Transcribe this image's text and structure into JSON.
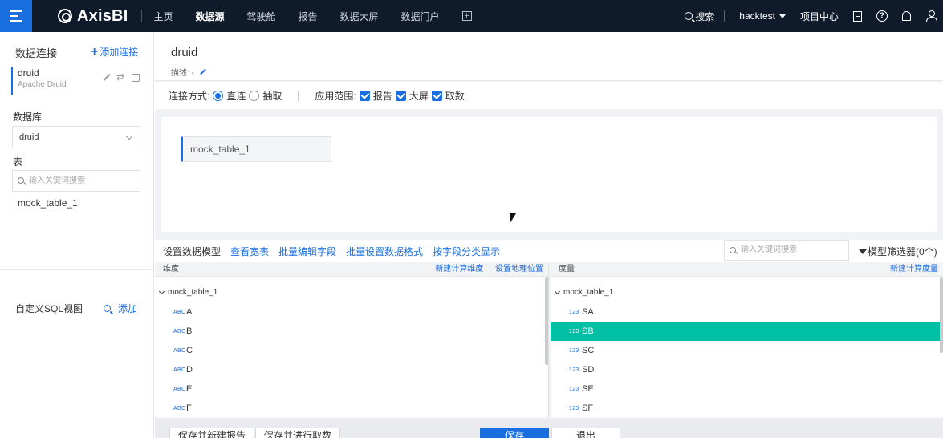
{
  "topbar": {
    "logo": "AxisBI",
    "nav": [
      "主页",
      "数据源",
      "驾驶舱",
      "报告",
      "数据大屏",
      "数据门户"
    ],
    "active_nav": "数据源",
    "search": "搜索",
    "user": "hacktest",
    "project_center": "项目中心",
    "accent": "#1a6fe0",
    "bg": "#0f1a2b"
  },
  "left": {
    "title": "数据连接",
    "add_link": "添加连接",
    "connection": {
      "name": "druid",
      "type": "Apache Druid"
    },
    "database_label": "数据库",
    "database_value": "druid",
    "table_label": "表",
    "search_placeholder": "输入关键词搜索",
    "tables": [
      "mock_table_1"
    ],
    "sql_view_title": "自定义SQL视图",
    "sql_add": "添加"
  },
  "main": {
    "title": "druid",
    "desc": "描述: -",
    "conn_mode_label": "连接方式:",
    "mode_direct": "直连",
    "mode_extract": "抽取",
    "scope_label": "应用范围:",
    "scope_report": "报告",
    "scope_screen": "大屏",
    "scope_fetch": "取数",
    "canvas_table": "mock_table_1"
  },
  "toolbar": {
    "items": [
      "设置数据模型",
      "查看宽表",
      "批量编辑字段",
      "批量设置数据格式",
      "按字段分类显示"
    ],
    "search_placeholder": "输入关键词搜索",
    "filter": "模型筛选器(0个)"
  },
  "dimension": {
    "header": "维度",
    "link1": "新建计算维度",
    "link2": "设置地理位置",
    "root": "mock_table_1",
    "fields": [
      {
        "tag": "ABC",
        "name": "A"
      },
      {
        "tag": "ABC",
        "name": "B"
      },
      {
        "tag": "ABC",
        "name": "C"
      },
      {
        "tag": "ABC",
        "name": "D"
      },
      {
        "tag": "ABC",
        "name": "E"
      },
      {
        "tag": "ABC",
        "name": "F"
      }
    ]
  },
  "measure": {
    "header": "度量",
    "link1": "新建计算度量",
    "root": "mock_table_1",
    "selected_color": "#00bfa5",
    "fields": [
      {
        "tag": "123",
        "name": "SA"
      },
      {
        "tag": "123",
        "name": "SB"
      },
      {
        "tag": "123",
        "name": "SC"
      },
      {
        "tag": "123",
        "name": "SD"
      },
      {
        "tag": "123",
        "name": "SE"
      },
      {
        "tag": "123",
        "name": "SF"
      }
    ],
    "selected": "SB"
  },
  "footer": {
    "btn1": "保存并新建报告",
    "btn2": "保存并进行取数",
    "btn3": "保存",
    "btn4": "退出"
  }
}
